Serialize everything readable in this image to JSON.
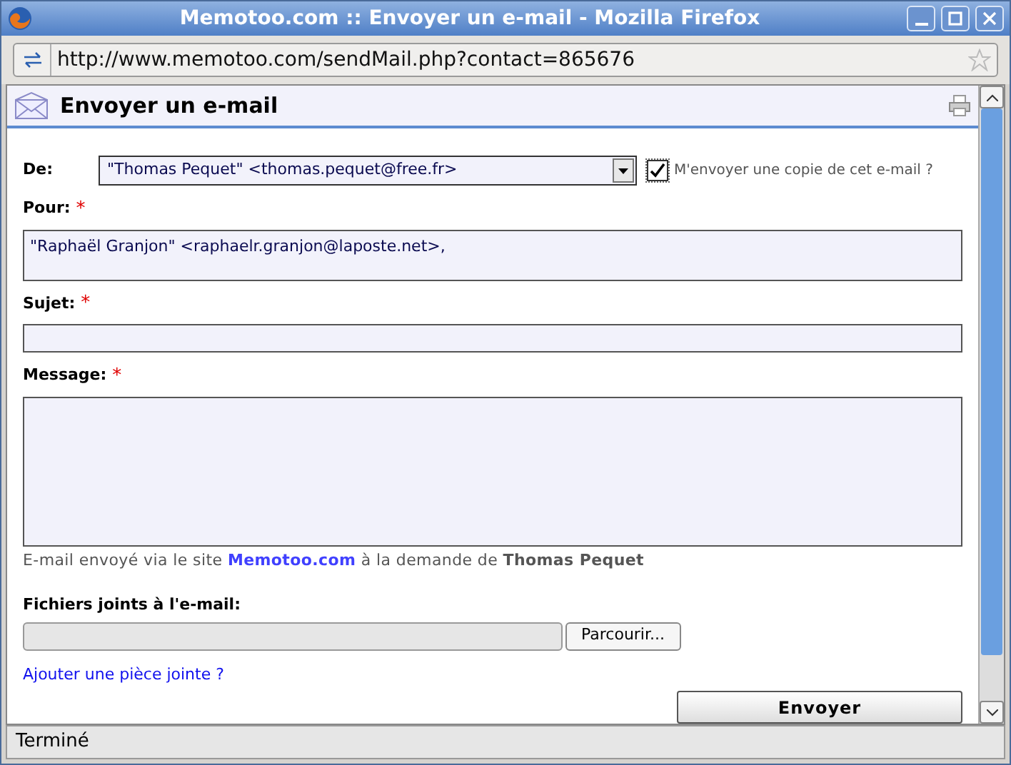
{
  "window": {
    "title": "Memotoo.com :: Envoyer un e-mail - Mozilla Firefox"
  },
  "address_bar": {
    "url": "http://www.memotoo.com/sendMail.php?contact=865676"
  },
  "page": {
    "heading": "Envoyer un e-mail"
  },
  "form": {
    "from": {
      "label": "De:",
      "value": "\"Thomas Pequet\" <thomas.pequet@free.fr>",
      "copy_label": "M'envoyer une copie de cet e-mail ?",
      "copy_checked": true
    },
    "fields": [
      {
        "label": "Pour:",
        "required": true,
        "kind": "textarea-small",
        "value": "\"Raphaël Granjon\" <raphaelr.granjon@laposte.net>,"
      },
      {
        "label": "Sujet:",
        "required": true,
        "kind": "input"
      },
      {
        "label": "Message:",
        "required": true,
        "kind": "textarea"
      }
    ],
    "required_mark": "*",
    "footer_note": {
      "before": "E-mail envoyé via le site",
      "link": "Memotoo.com",
      "after": "à la demande de **Thomas Pequet**"
    },
    "attachments": {
      "label": "Fichiers joints à l'e-mail:",
      "browse_button": "Parcourir...",
      "add_link": "Ajouter une pièce jointe ?"
    },
    "submit": "Envoyer"
  },
  "status_bar": {
    "text": "Terminé"
  }
}
